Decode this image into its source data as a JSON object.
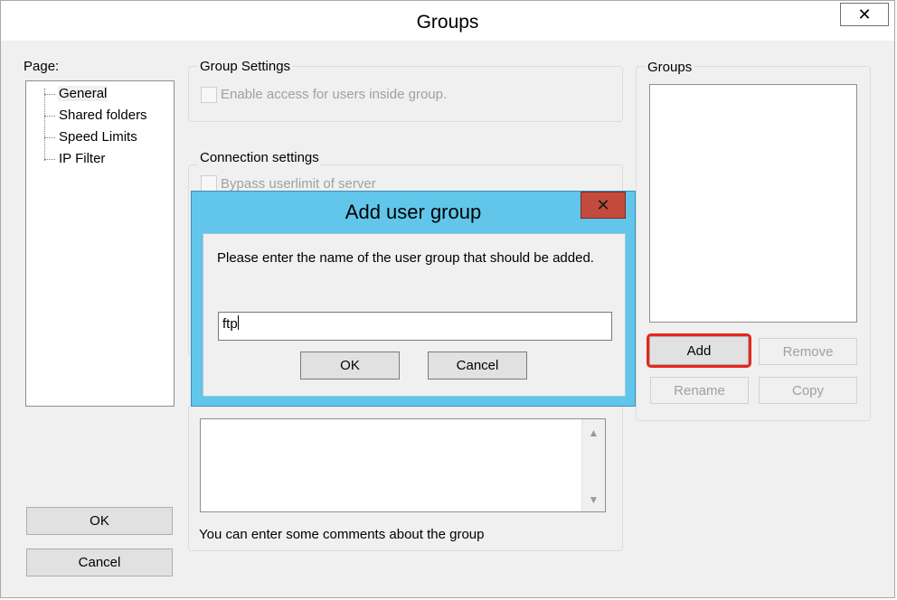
{
  "window": {
    "title": "Groups",
    "close_glyph": "✕"
  },
  "page_panel": {
    "label": "Page:",
    "items": [
      {
        "label": "General",
        "selected": true
      },
      {
        "label": "Shared folders",
        "selected": false
      },
      {
        "label": "Speed Limits",
        "selected": false
      },
      {
        "label": "IP Filter",
        "selected": false
      }
    ],
    "ok_label": "OK",
    "cancel_label": "Cancel"
  },
  "group_settings": {
    "caption": "Group Settings",
    "enable_access_label": "Enable access for users inside group.",
    "enable_access_checked": false
  },
  "connection_settings": {
    "caption": "Connection settings",
    "bypass_userlimit_label": "Bypass userlimit of server",
    "bypass_userlimit_checked": false
  },
  "comments": {
    "value": "",
    "hint": "You can enter some comments about the group",
    "scroll_up_glyph": "▲",
    "scroll_down_glyph": "▼"
  },
  "groups_panel": {
    "caption": "Groups",
    "items": [],
    "add_label": "Add",
    "remove_label": "Remove",
    "rename_label": "Rename",
    "copy_label": "Copy"
  },
  "modal": {
    "title": "Add user group",
    "close_glyph": "✕",
    "prompt": "Please enter the name of the user group that should be added.",
    "input_value": "ftp",
    "ok_label": "OK",
    "cancel_label": "Cancel"
  },
  "colors": {
    "modal_frame": "#61c6ea",
    "modal_close": "#c44a3e",
    "highlight": "#e8261c",
    "window_bg": "#f0f0f0"
  }
}
